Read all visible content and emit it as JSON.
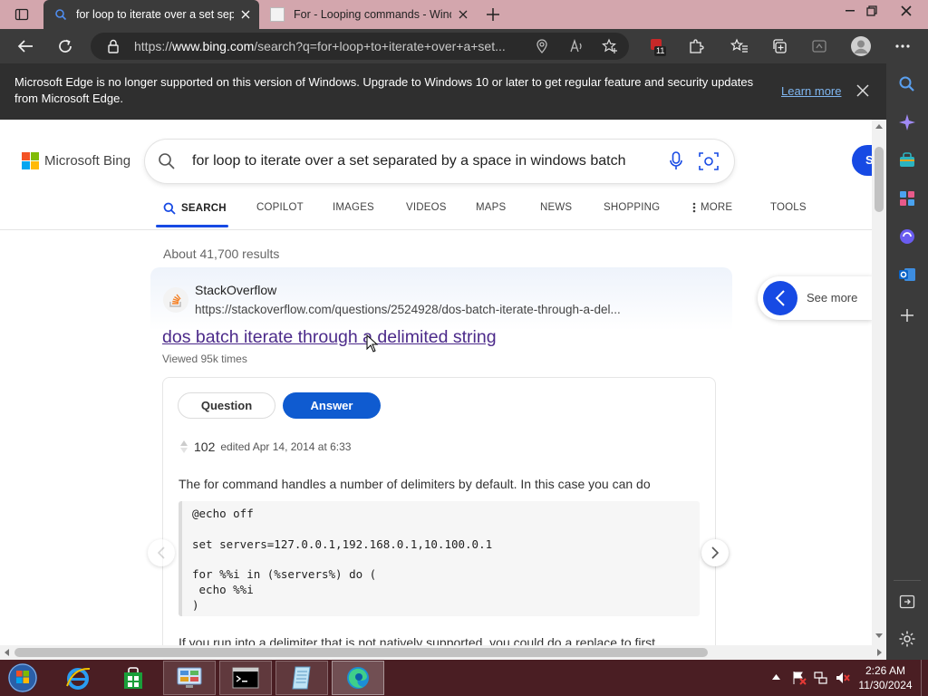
{
  "browser": {
    "tabs": [
      {
        "label": "for loop to iterate over a set separated by a space in windows batch",
        "active": true
      },
      {
        "label": "For - Looping commands - Windows CMD",
        "active": false
      }
    ],
    "address_url_prefix": "https://",
    "address_url_host": "www.bing.com",
    "address_url_rest": "/search?q=for+loop+to+iterate+over+a+set...",
    "extension_badge": "11"
  },
  "infobar": {
    "message": "Microsoft Edge is no longer supported on this version of Windows. Upgrade to Windows 10 or later to get regular feature and security updates from Microsoft Edge.",
    "link": "Learn more"
  },
  "bing": {
    "logo_text": "Microsoft Bing",
    "query": "for loop to iterate over a set separated by a space in windows batch",
    "nav": [
      "SEARCH",
      "COPILOT",
      "IMAGES",
      "VIDEOS",
      "MAPS",
      "NEWS",
      "SHOPPING",
      "MORE",
      "TOOLS"
    ],
    "results_count": "About 41,700 results",
    "signin_initial": "S"
  },
  "result": {
    "site": "StackOverflow",
    "url": "https://stackoverflow.com/questions/2524928/dos-batch-iterate-through-a-del...",
    "title": "dos batch iterate through a delimited string",
    "views": "Viewed 95k times",
    "tab_question": "Question",
    "tab_answer": "Answer",
    "votes": "102",
    "edited": "edited Apr 14, 2014 at 6:33",
    "para1": "The for command handles a number of delimiters by default. In this case you can do",
    "code_lines": [
      "@echo off",
      "",
      "set servers=127.0.0.1,192.168.0.1,10.100.0.1",
      "",
      "for %%i in (%servers%) do (",
      " echo %%i",
      ")"
    ],
    "para2": "If you run into a delimiter that is not natively supported, you could do a replace to first",
    "see_more": "See more"
  },
  "taskbar": {
    "time": "2:26 AM",
    "date": "11/30/2024"
  },
  "colors": {
    "titlebar": "#d3a6ad",
    "toolbar": "#3b3b3b",
    "taskbar": "#4a1e23",
    "bing_blue": "#174ae4",
    "visited_link": "#4c2a8a"
  }
}
